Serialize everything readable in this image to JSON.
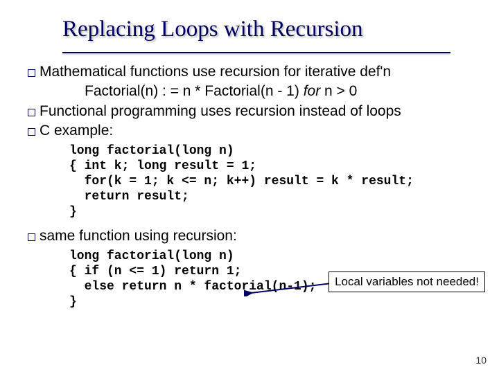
{
  "title": "Replacing Loops with Recursion",
  "bullets": {
    "b1": "Mathematical functions use recursion for iterative def'n",
    "formula_plain_a": "Factorial(n) : = n * Factorial(n - 1)   ",
    "formula_ital": "for ",
    "formula_plain_b": "n > 0",
    "b2": "Functional programming uses recursion instead of loops",
    "b3": "C example:",
    "b4": "same function using recursion:"
  },
  "code1": "long factorial(long n)\n{ int k; long result = 1;\n  for(k = 1; k <= n; k++) result = k * result;\n  return result;\n}",
  "code2": "long factorial(long n)\n{ if (n <= 1) return 1;\n  else return n * factorial(n-1);\n}",
  "callout": "Local variables not needed!",
  "page": "10"
}
